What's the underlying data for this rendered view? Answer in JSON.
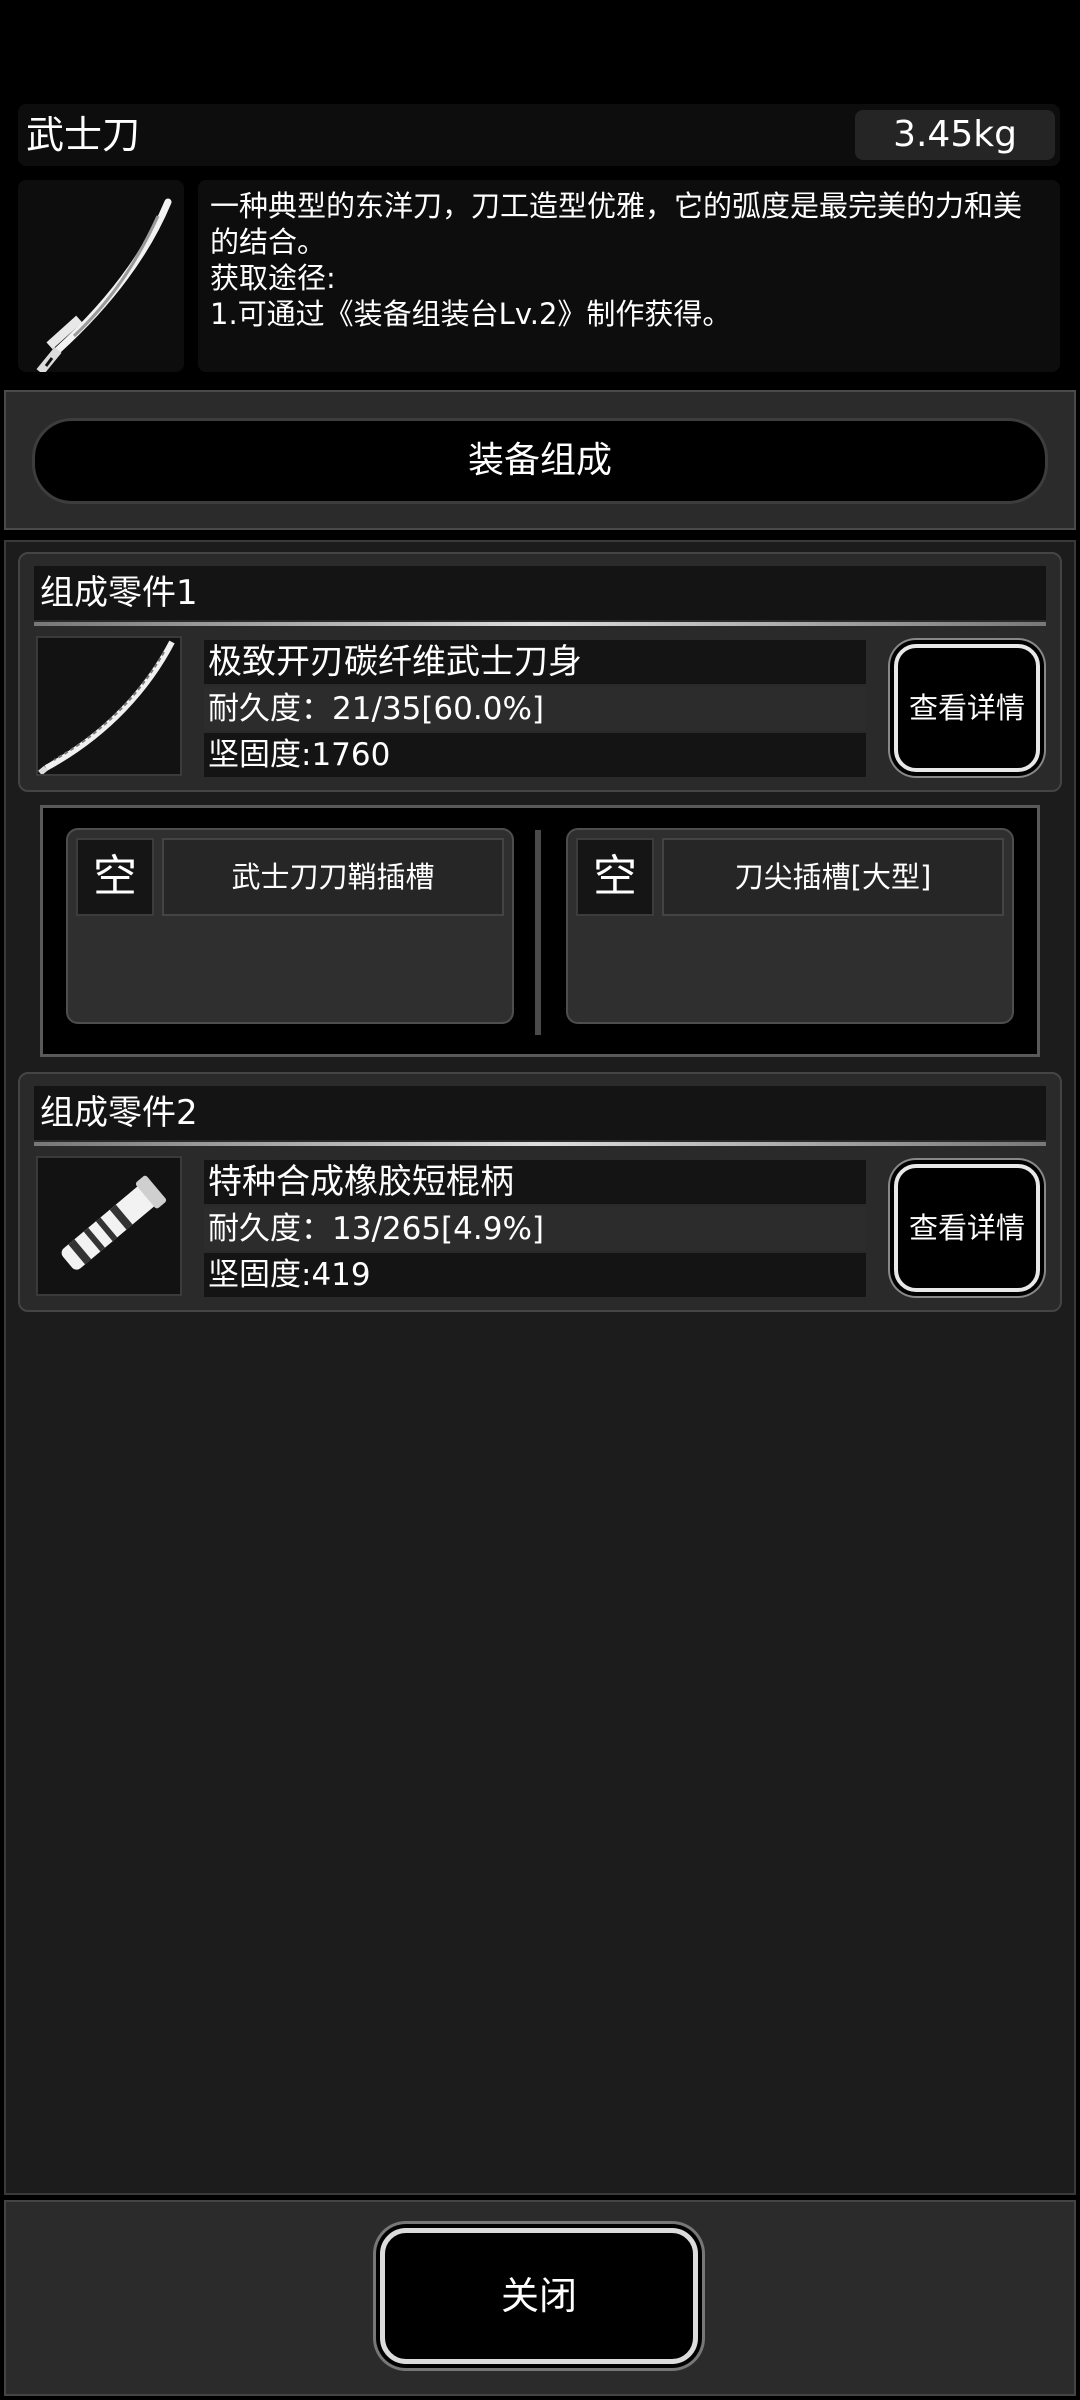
{
  "item": {
    "name": "武士刀",
    "weight": "3.45kg",
    "description_lines": [
      "一种典型的东洋刀，刀工造型优雅，它的弧度是最完美的力和美",
      "的结合。",
      "获取途径:",
      "1.可通过《装备组装台Lv.2》制作获得。"
    ]
  },
  "section_header": "装备组成",
  "parts": [
    {
      "title": "组成零件1",
      "name": "极致开刃碳纤维武士刀身",
      "durability": "耐久度：21/35[60.0%]",
      "hardness": "坚固度:1760",
      "detail_button": "查看详情",
      "icon": "katana-blade-icon"
    },
    {
      "title": "组成零件2",
      "name": "特种合成橡胶短棍柄",
      "durability": "耐久度：13/265[4.9%]",
      "hardness": "坚固度:419",
      "detail_button": "查看详情",
      "icon": "rubber-handle-icon"
    }
  ],
  "slots": [
    {
      "status": "空",
      "label": "武士刀刀鞘插槽"
    },
    {
      "status": "空",
      "label": "刀尖插槽[大型]"
    }
  ],
  "close_button": "关闭"
}
